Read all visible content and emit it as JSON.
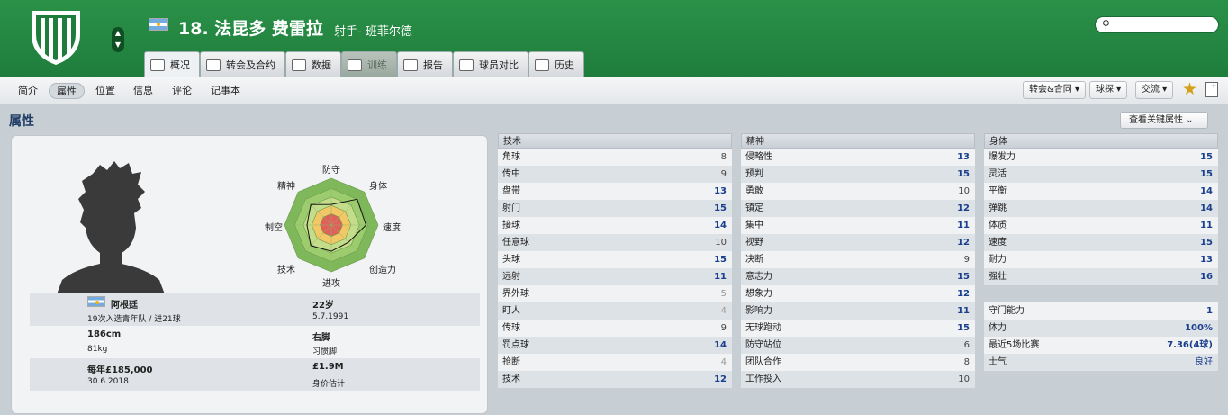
{
  "header": {
    "title": "18. 法昆多 费雷拉",
    "subtitle": "射手- 班菲尔德",
    "nationality_flag": "argentina-flag-icon",
    "search_placeholder": ""
  },
  "tabs": [
    {
      "label": "概况",
      "icon": "profile-icon",
      "state": "active"
    },
    {
      "label": "转会及合约",
      "icon": "document-icon",
      "state": "normal"
    },
    {
      "label": "数据",
      "icon": "bar-chart-icon",
      "state": "normal"
    },
    {
      "label": "训练",
      "icon": "cloud-icon",
      "state": "disabled"
    },
    {
      "label": "报告",
      "icon": "report-icon",
      "state": "normal"
    },
    {
      "label": "球员对比",
      "icon": "compare-icon",
      "state": "normal"
    },
    {
      "label": "历史",
      "icon": "history-icon",
      "state": "normal"
    }
  ],
  "subnav": {
    "items": [
      "简介",
      "属性",
      "位置",
      "信息",
      "评论",
      "记事本"
    ],
    "active": "属性",
    "right": {
      "transfer": "转会&合同",
      "scout": "球探",
      "interact": "交流"
    }
  },
  "section": {
    "title": "属性",
    "key_attributes_button": "查看关键属性"
  },
  "player_info": {
    "nationality": "阿根廷",
    "youth_caps": "19次入选青年队 / 进21球",
    "age": "22岁",
    "dob": "5.7.1991",
    "height": "186cm",
    "weight": "81kg",
    "foot": "右脚",
    "foot_label": "习惯脚",
    "wage": "每年£185,000",
    "contract_end": "30.6.2018",
    "value": "£1.9M",
    "value_label": "身价估计"
  },
  "radar": {
    "labels": [
      "防守",
      "身体",
      "速度",
      "创造力",
      "进攻",
      "技术",
      "制空",
      "精神"
    ],
    "levels": [
      0.44,
      0.78,
      0.74,
      0.52,
      0.56,
      0.62,
      0.52,
      0.62
    ],
    "colors": {
      "outer": "#7fb85a",
      "mid": "#c4dd8a",
      "inner": "#f2c765",
      "core": "#e0605a"
    }
  },
  "attributes": {
    "technical": {
      "title": "技术",
      "rows": [
        {
          "name": "角球",
          "value": "8"
        },
        {
          "name": "传中",
          "value": "9"
        },
        {
          "name": "盘带",
          "value": "13"
        },
        {
          "name": "射门",
          "value": "15"
        },
        {
          "name": "接球",
          "value": "14"
        },
        {
          "name": "任意球",
          "value": "10"
        },
        {
          "name": "头球",
          "value": "15"
        },
        {
          "name": "远射",
          "value": "11"
        },
        {
          "name": "界外球",
          "value": "5"
        },
        {
          "name": "盯人",
          "value": "4"
        },
        {
          "name": "传球",
          "value": "9"
        },
        {
          "name": "罚点球",
          "value": "14"
        },
        {
          "name": "抢断",
          "value": "4"
        },
        {
          "name": "技术",
          "value": "12"
        }
      ]
    },
    "mental": {
      "title": "精神",
      "rows": [
        {
          "name": "侵略性",
          "value": "13"
        },
        {
          "name": "预判",
          "value": "15"
        },
        {
          "name": "勇敢",
          "value": "10"
        },
        {
          "name": "镇定",
          "value": "12"
        },
        {
          "name": "集中",
          "value": "11"
        },
        {
          "name": "视野",
          "value": "12"
        },
        {
          "name": "决断",
          "value": "9"
        },
        {
          "name": "意志力",
          "value": "15"
        },
        {
          "name": "想象力",
          "value": "12"
        },
        {
          "name": "影响力",
          "value": "11"
        },
        {
          "name": "无球跑动",
          "value": "15"
        },
        {
          "name": "防守站位",
          "value": "6"
        },
        {
          "name": "团队合作",
          "value": "8"
        },
        {
          "name": "工作投入",
          "value": "10"
        }
      ]
    },
    "physical": {
      "title": "身体",
      "rows": [
        {
          "name": "爆发力",
          "value": "15"
        },
        {
          "name": "灵活",
          "value": "15"
        },
        {
          "name": "平衡",
          "value": "14"
        },
        {
          "name": "弹跳",
          "value": "14"
        },
        {
          "name": "体质",
          "value": "11"
        },
        {
          "name": "速度",
          "value": "15"
        },
        {
          "name": "耐力",
          "value": "13"
        },
        {
          "name": "强壮",
          "value": "16"
        }
      ],
      "extra": [
        {
          "name": "守门能力",
          "value": "1"
        },
        {
          "name": "体力",
          "value": "100%"
        },
        {
          "name": "最近5场比赛",
          "value": "7.36(4球)"
        },
        {
          "name": "士气",
          "value": "良好"
        }
      ]
    }
  }
}
